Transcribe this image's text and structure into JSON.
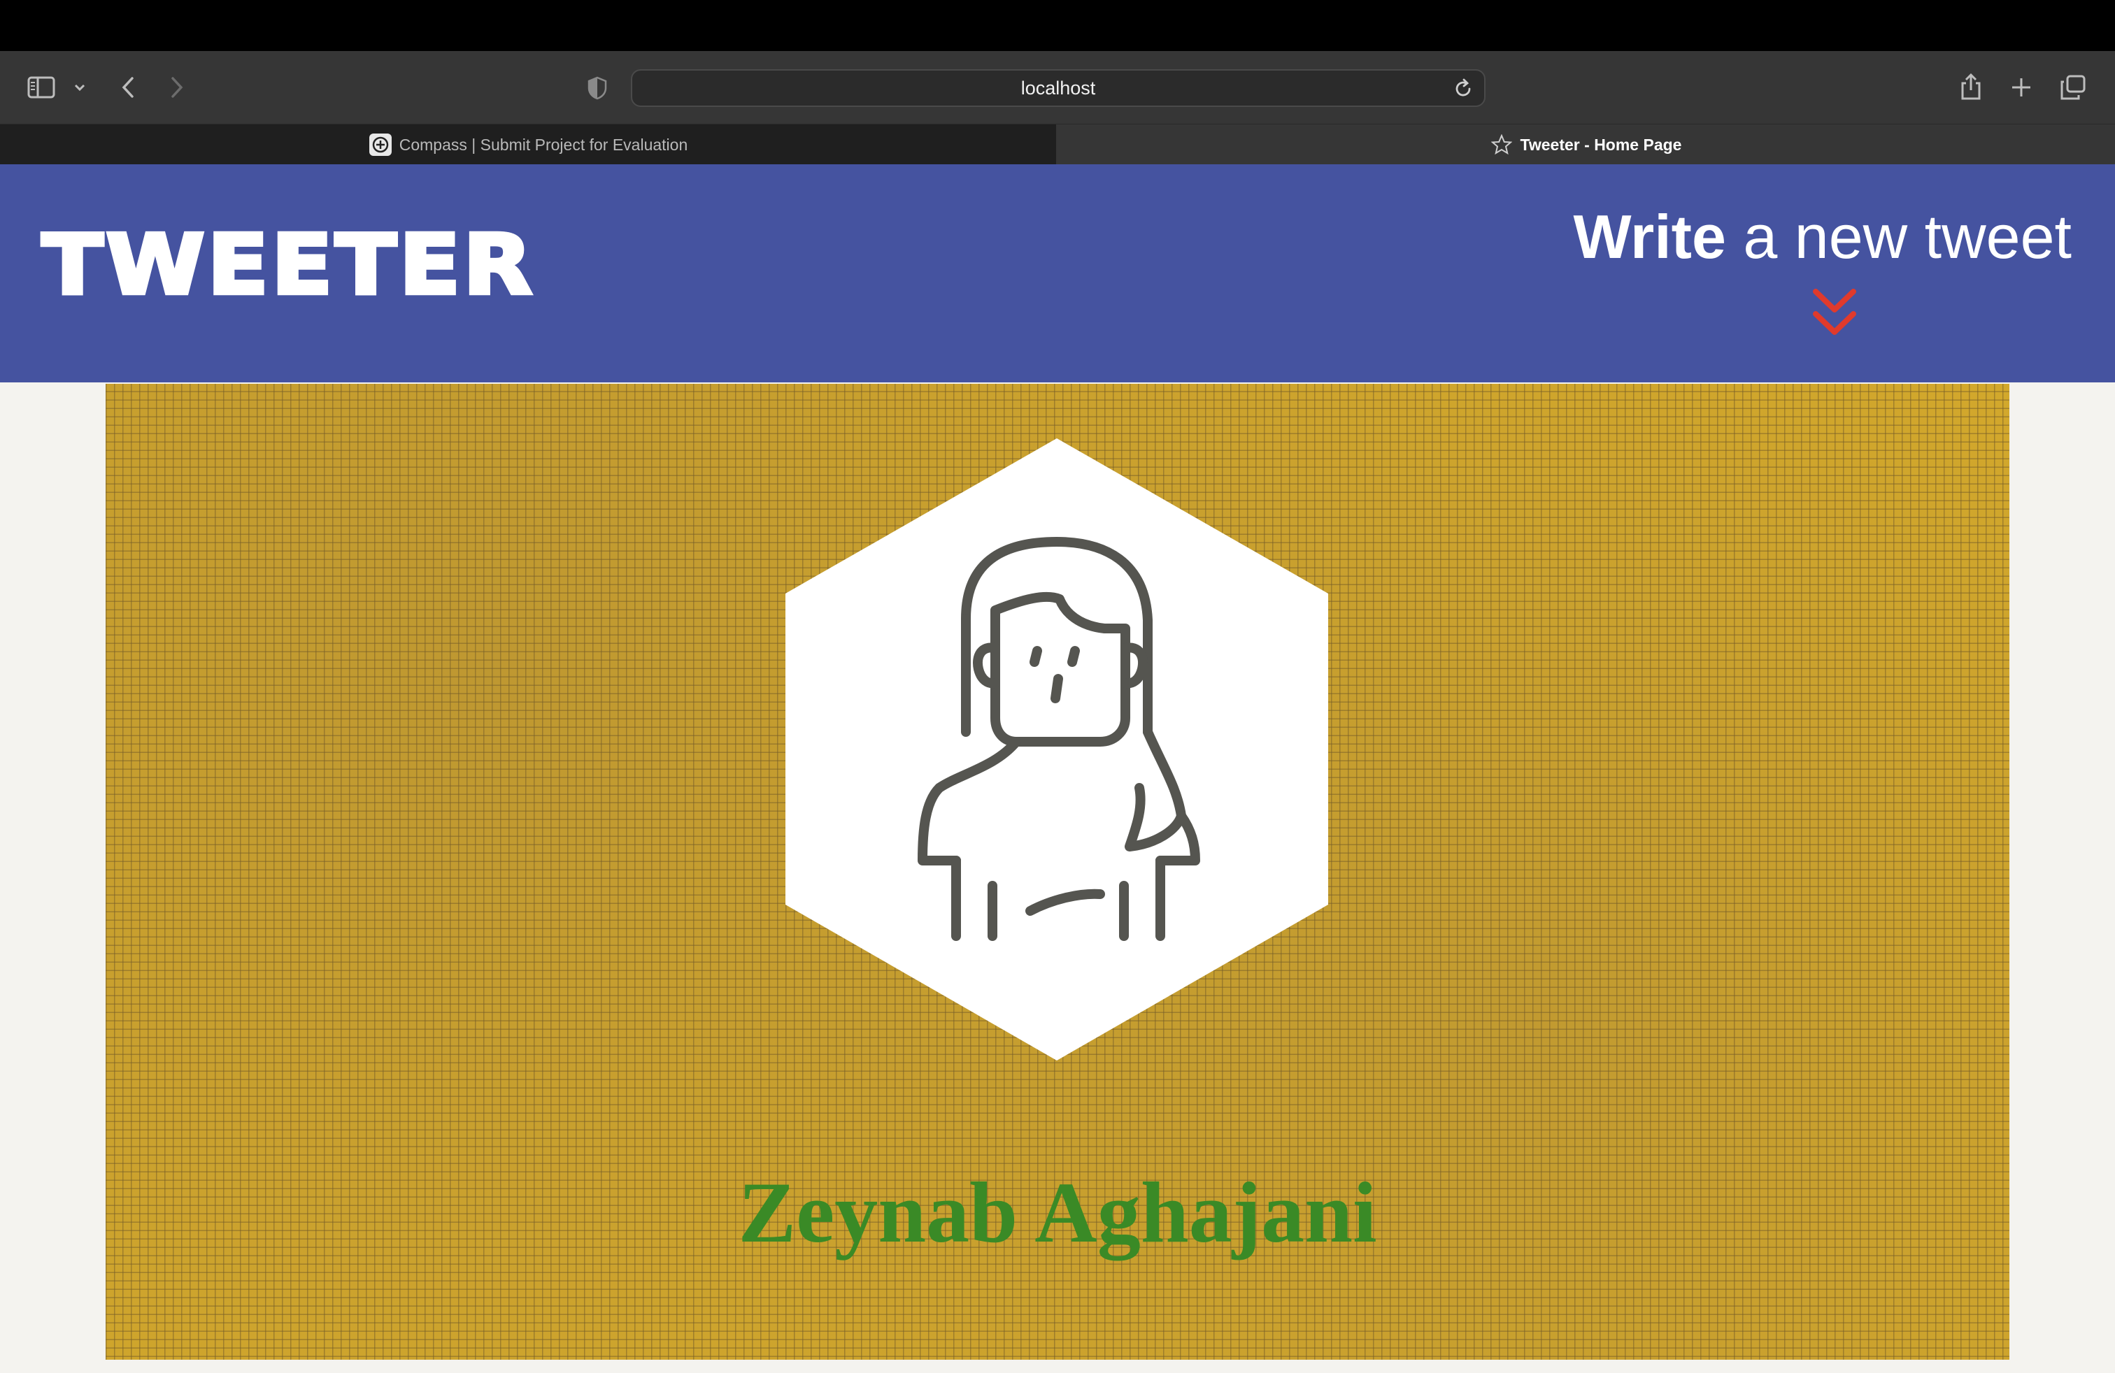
{
  "browser": {
    "address": "localhost",
    "tabs": [
      {
        "label": "Compass | Submit Project for Evaluation",
        "active": false,
        "favicon": "compass-icon"
      },
      {
        "label": "Tweeter - Home Page",
        "active": true,
        "favicon": "star-icon"
      }
    ],
    "icons": {
      "sidebar": "sidebar-icon",
      "dropdown": "chevron-down-icon",
      "back": "back-arrow-icon",
      "forward": "forward-arrow-icon",
      "privacy": "shield-icon",
      "reload": "reload-icon",
      "share": "share-icon",
      "new_tab": "plus-icon",
      "tabs_overview": "tabs-overview-icon"
    }
  },
  "header": {
    "logo": "TWEETER",
    "write_bold": "Write",
    "write_rest": " a new tweet",
    "write_icon": "double-chevron-down-icon",
    "colors": {
      "background": "#4553a0",
      "chevron": "#e03a2c"
    }
  },
  "profile": {
    "name": "Zeynab Aghajani",
    "avatar_icon": "woman-avatar-icon",
    "colors": {
      "banner": "#d4a92b",
      "name": "#3a8a26"
    }
  }
}
